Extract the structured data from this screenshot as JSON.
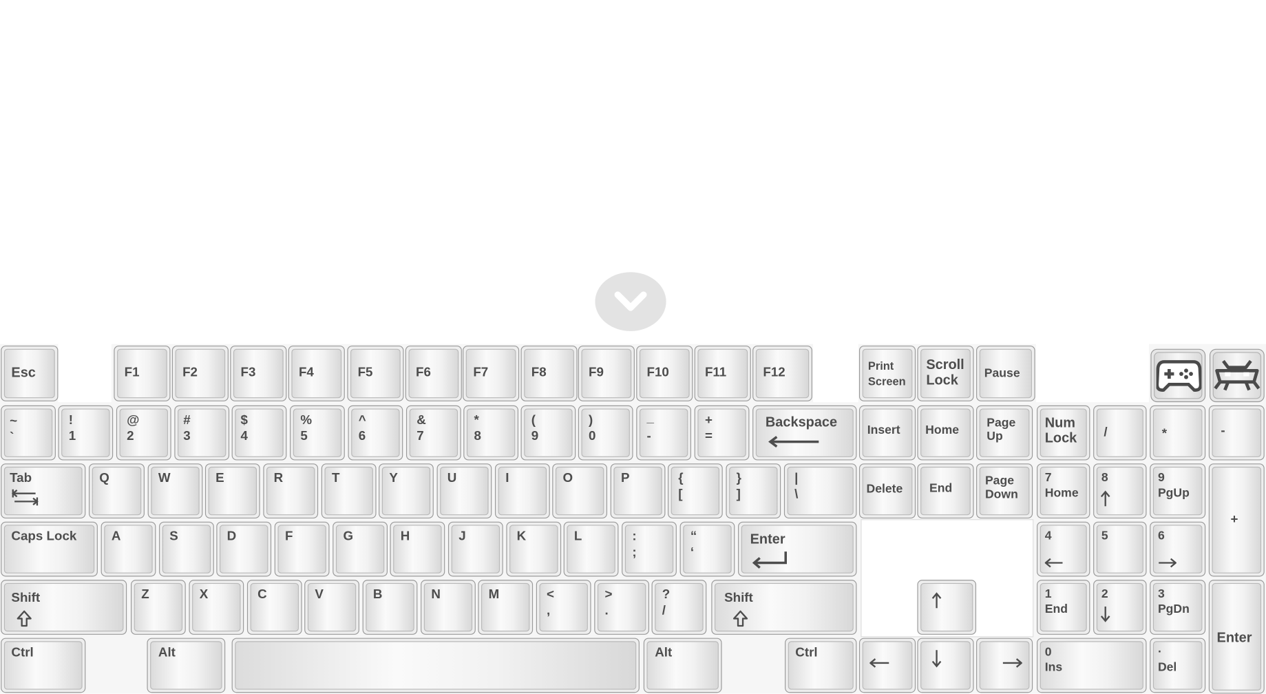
{
  "keyboard": {
    "function_row": {
      "esc": "Esc",
      "f_keys": [
        "F1",
        "F2",
        "F3",
        "F4",
        "F5",
        "F6",
        "F7",
        "F8",
        "F9",
        "F10",
        "F11",
        "F12"
      ],
      "print_screen": "Print\nScreen",
      "scroll_lock": "Scroll\nLock",
      "pause": "Pause"
    },
    "number_row": [
      {
        "top": "~",
        "bottom": "`"
      },
      {
        "top": "!",
        "bottom": "1"
      },
      {
        "top": "@",
        "bottom": "2"
      },
      {
        "top": "#",
        "bottom": "3"
      },
      {
        "top": "$",
        "bottom": "4"
      },
      {
        "top": "%",
        "bottom": "5"
      },
      {
        "top": "^",
        "bottom": "6"
      },
      {
        "top": "&",
        "bottom": "7"
      },
      {
        "top": "*",
        "bottom": "8"
      },
      {
        "top": "(",
        "bottom": "9"
      },
      {
        "top": ")",
        "bottom": "0"
      },
      {
        "top": "_",
        "bottom": "-"
      },
      {
        "top": "+",
        "bottom": "="
      }
    ],
    "backspace": "Backspace",
    "tab": "Tab",
    "qwerty_row": [
      "Q",
      "W",
      "E",
      "R",
      "T",
      "Y",
      "U",
      "I",
      "O",
      "P"
    ],
    "brackets": [
      {
        "top": "{",
        "bottom": "["
      },
      {
        "top": "}",
        "bottom": "]"
      },
      {
        "top": "|",
        "bottom": "\\"
      }
    ],
    "caps_lock": "Caps Lock",
    "home_row": [
      "A",
      "S",
      "D",
      "F",
      "G",
      "H",
      "J",
      "K",
      "L"
    ],
    "home_punct": [
      {
        "top": ":",
        "bottom": ";"
      },
      {
        "top": "“",
        "bottom": "‘"
      }
    ],
    "enter": "Enter",
    "shift": "Shift",
    "bottom_letters": [
      "Z",
      "X",
      "C",
      "V",
      "B",
      "N",
      "M"
    ],
    "bottom_punct": [
      {
        "top": "<",
        "bottom": ","
      },
      {
        "top": ">",
        "bottom": "."
      },
      {
        "top": "?",
        "bottom": "/"
      }
    ],
    "ctrl": "Ctrl",
    "alt": "Alt",
    "nav_cluster": {
      "insert": "Insert",
      "home": "Home",
      "page_up": "Page\nUp",
      "delete": "Delete",
      "end": "End",
      "page_down": "Page\nDown"
    },
    "numpad": {
      "num_lock": "Num\nLock",
      "divide": "/",
      "multiply": "*",
      "minus": "-",
      "plus": "+",
      "enter": "Enter",
      "n7": {
        "top": "7",
        "bottom": "Home"
      },
      "n8": {
        "top": "8"
      },
      "n9": {
        "top": "9",
        "bottom": "PgUp"
      },
      "n4": {
        "top": "4"
      },
      "n5": {
        "top": "5"
      },
      "n6": {
        "top": "6"
      },
      "n1": {
        "top": "1",
        "bottom": "End"
      },
      "n2": {
        "top": "2"
      },
      "n3": {
        "top": "3",
        "bottom": "PgDn"
      },
      "n0": {
        "top": "0",
        "bottom": "Ins"
      },
      "ndot": {
        "top": ".",
        "bottom": "Del"
      }
    }
  },
  "icons": {
    "collapse": "chevron-down-icon",
    "gamepad": "gamepad-icon",
    "retroarch": "retroarch-invader-icon"
  },
  "colors": {
    "key_face": "#f2f2f2",
    "key_border": "#9a9a9a",
    "legend": "#4d4d4d",
    "collapse_bg": "#e3e3e3"
  }
}
